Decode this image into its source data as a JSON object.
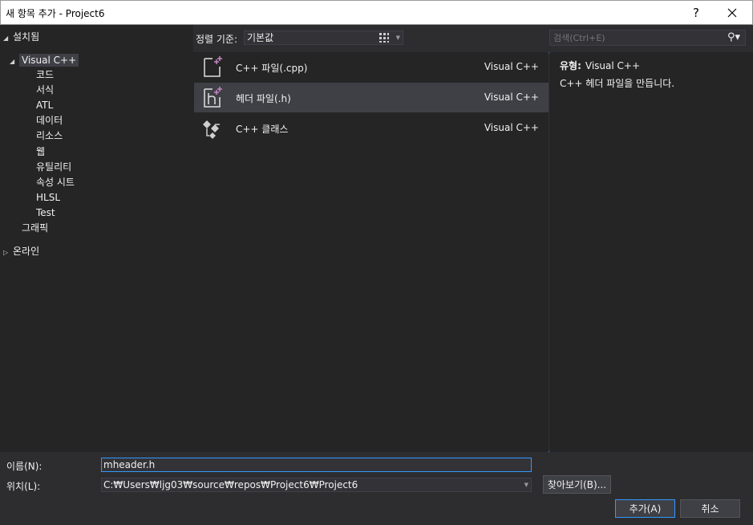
{
  "window": {
    "title": "새 항목 추가 - Project6",
    "help": "?",
    "close": "✕"
  },
  "tree": {
    "installed": "설치됨",
    "visual_cpp": "Visual C++",
    "children": [
      "코드",
      "서식",
      "ATL",
      "데이터",
      "리소스",
      "웹",
      "유틸리티",
      "속성 시트",
      "HLSL",
      "Test"
    ],
    "graphics": "그래픽",
    "online": "온라인"
  },
  "sortbar": {
    "label": "정렬 기준:",
    "value": "기본값"
  },
  "search": {
    "placeholder": "검색(Ctrl+E)"
  },
  "templates": [
    {
      "name": "C++ 파일(.cpp)",
      "lang": "Visual C++",
      "icon": "cpp-file-icon"
    },
    {
      "name": "헤더 파일(.h)",
      "lang": "Visual C++",
      "icon": "header-file-icon"
    },
    {
      "name": "C++ 클래스",
      "lang": "Visual C++",
      "icon": "cpp-class-icon"
    }
  ],
  "description": {
    "type_label": "유형:",
    "type_value": "Visual C++",
    "text": "C++ 헤더 파일을 만듭니다."
  },
  "form": {
    "name_label": "이름(N):",
    "name_value": "mheader.h",
    "location_label": "위치(L):",
    "location_value": "C:₩Users₩ljg03₩source₩repos₩Project6₩Project6",
    "browse": "찾아보기(B)...",
    "add": "추가(A)",
    "cancel": "취소"
  },
  "colors": {
    "accent": "#3399ff",
    "cpp_plus": "#c586c0",
    "background": "#2d2d30",
    "panel": "#252526",
    "selected": "#3f3f46"
  }
}
